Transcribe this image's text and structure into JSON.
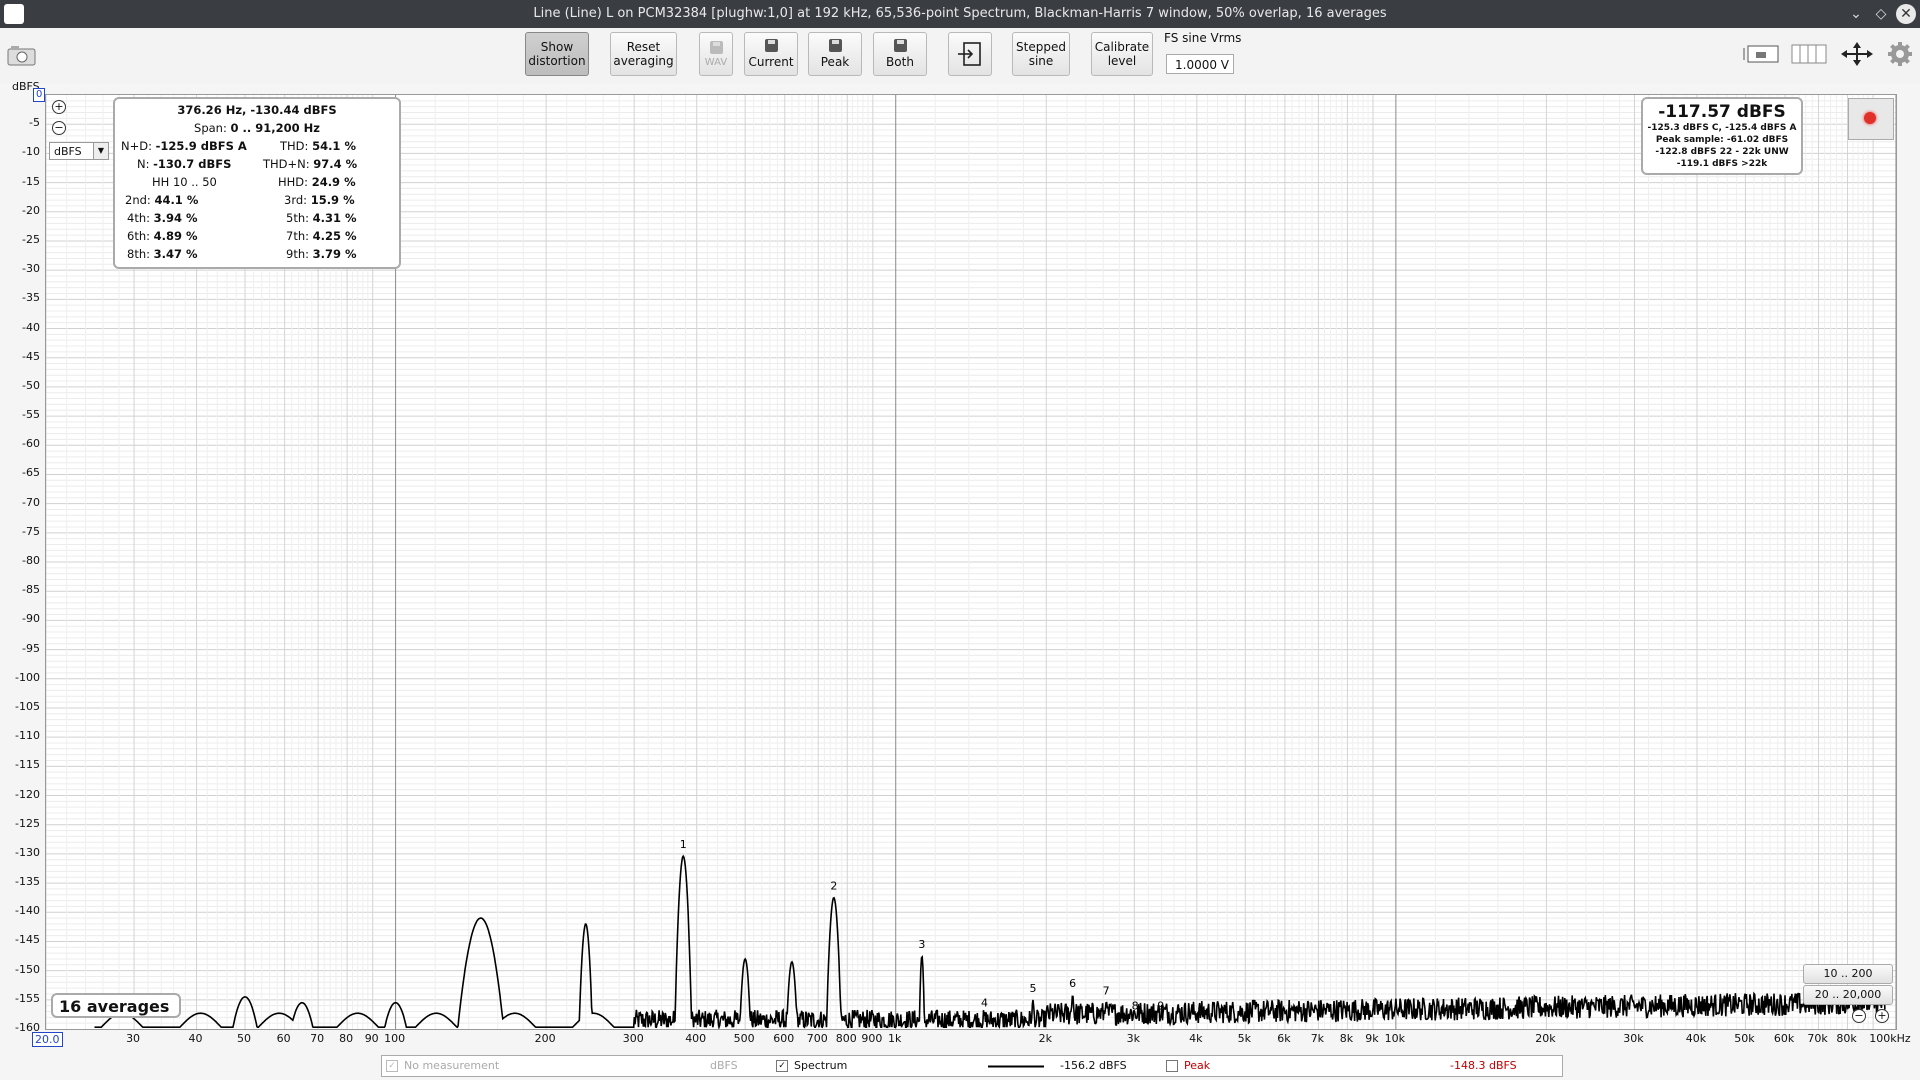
{
  "window": {
    "title": "Line (Line) L on PCM32384 [plughw:1,0] at 192 kHz, 65,536-point Spectrum, Blackman-Harris 7 window, 50% overlap, 16 averages"
  },
  "toolbar": {
    "show_distortion": [
      "Show",
      "distortion"
    ],
    "reset_averaging": [
      "Reset",
      "averaging"
    ],
    "wav": "WAV",
    "current": "Current",
    "peak": "Peak",
    "both": "Both",
    "stepped_sine": [
      "Stepped",
      "sine"
    ],
    "calibrate_level": [
      "Calibrate",
      "level"
    ],
    "fs_label": "FS sine Vrms",
    "fs_value": "1.0000 V"
  },
  "axis": {
    "y_unit": "dBFS",
    "y_max_box": "0",
    "x_min_box": "20.0",
    "y_ticks": [
      "-5",
      "-10",
      "-15",
      "-20",
      "-25",
      "-30",
      "-35",
      "-40",
      "-45",
      "-50",
      "-55",
      "-60",
      "-65",
      "-70",
      "-75",
      "-80",
      "-85",
      "-90",
      "-95",
      "-100",
      "-105",
      "-110",
      "-115",
      "-120",
      "-125",
      "-130",
      "-135",
      "-140",
      "-145",
      "-150",
      "-155",
      "-160"
    ],
    "x_ticks": [
      "30",
      "40",
      "50",
      "60",
      "70",
      "80",
      "90",
      "100",
      "200",
      "300",
      "400",
      "500",
      "600",
      "700",
      "800",
      "900",
      "1k",
      "2k",
      "3k",
      "4k",
      "5k",
      "6k",
      "7k",
      "8k",
      "9k",
      "10k",
      "20k",
      "30k",
      "40k",
      "50k",
      "60k",
      "70k",
      "80k",
      "100kHz"
    ],
    "unit_select": "dBFS"
  },
  "distortion": {
    "header": "376.26 Hz, -130.44 dBFS",
    "span_label": "Span:",
    "span_value": "0 .. 91,200 Hz",
    "nd_label": "N+D:",
    "nd_value": "-125.9 dBFS A",
    "thd_label": "THD:",
    "thd_value": "54.1 %",
    "n_label": "N:",
    "n_value": "-130.7 dBFS",
    "thdn_label": "THD+N:",
    "thdn_value": "97.4 %",
    "hh_label": "HH 10 .. 50",
    "hhd_label": "HHD:",
    "hhd_value": "24.9 %",
    "h2_label": "2nd:",
    "h2_value": "44.1 %",
    "h3_label": "3rd:",
    "h3_value": "15.9 %",
    "h4_label": "4th:",
    "h4_value": "3.94 %",
    "h5_label": "5th:",
    "h5_value": "4.31 %",
    "h6_label": "6th:",
    "h6_value": "4.89 %",
    "h7_label": "7th:",
    "h7_value": "4.25 %",
    "h8_label": "8th:",
    "h8_value": "3.47 %",
    "h9_label": "9th:",
    "h9_value": "3.79 %"
  },
  "level": {
    "main": "-117.57 dBFS",
    "line1": "-125.3 dBFS C, -125.4 dBFS A",
    "line2": "Peak sample: -61.02 dBFS",
    "line3": "-122.8 dBFS 22 - 22k UNW",
    "line4": "-119.1 dBFS >22k"
  },
  "averages_label": "16 averages",
  "range_buttons": [
    "10 .. 200",
    "20 .. 20,000"
  ],
  "legend": {
    "no_measurement": "No measurement",
    "no_measurement_unit": "dBFS",
    "spectrum": "Spectrum",
    "spectrum_value": "-156.2 dBFS",
    "peak": "Peak",
    "peak_value": "-148.3 dBFS"
  },
  "colors": {
    "trace": "#000000",
    "peak": "#c00000",
    "accent": "#2246c8",
    "record": "#e0302a"
  },
  "chart_data": {
    "type": "line",
    "xlabel": "",
    "ylabel": "dBFS",
    "x_scale": "log",
    "xlim": [
      20,
      100000
    ],
    "ylim": [
      -160,
      0
    ],
    "grid": true,
    "series": [
      {
        "name": "Spectrum",
        "color": "#000000"
      }
    ],
    "peaks": [
      {
        "f": 50,
        "db": -154.5
      },
      {
        "f": 65,
        "db": -155.5
      },
      {
        "f": 100,
        "db": -155.5
      },
      {
        "f": 148,
        "db": -141.0
      },
      {
        "f": 240,
        "db": -142.0
      },
      {
        "f": 376,
        "db": -130.4
      },
      {
        "f": 500,
        "db": -148.0
      },
      {
        "f": 620,
        "db": -148.5
      },
      {
        "f": 752,
        "db": -137.5
      },
      {
        "f": 1128,
        "db": -147.5
      }
    ],
    "harmonic_markers": [
      {
        "label": "1",
        "f": 376,
        "db": -130.4
      },
      {
        "label": "2",
        "f": 752,
        "db": -137.5
      },
      {
        "label": "3",
        "f": 1128,
        "db": -147.5
      },
      {
        "label": "4",
        "f": 1505,
        "db": -157.5
      },
      {
        "label": "5",
        "f": 1881,
        "db": -155.0
      },
      {
        "label": "6",
        "f": 2258,
        "db": -154.2
      },
      {
        "label": "7",
        "f": 2634,
        "db": -155.5
      },
      {
        "label": "8",
        "f": 3010,
        "db": -158.0
      },
      {
        "label": "9",
        "f": 3387,
        "db": -158.0
      }
    ]
  }
}
